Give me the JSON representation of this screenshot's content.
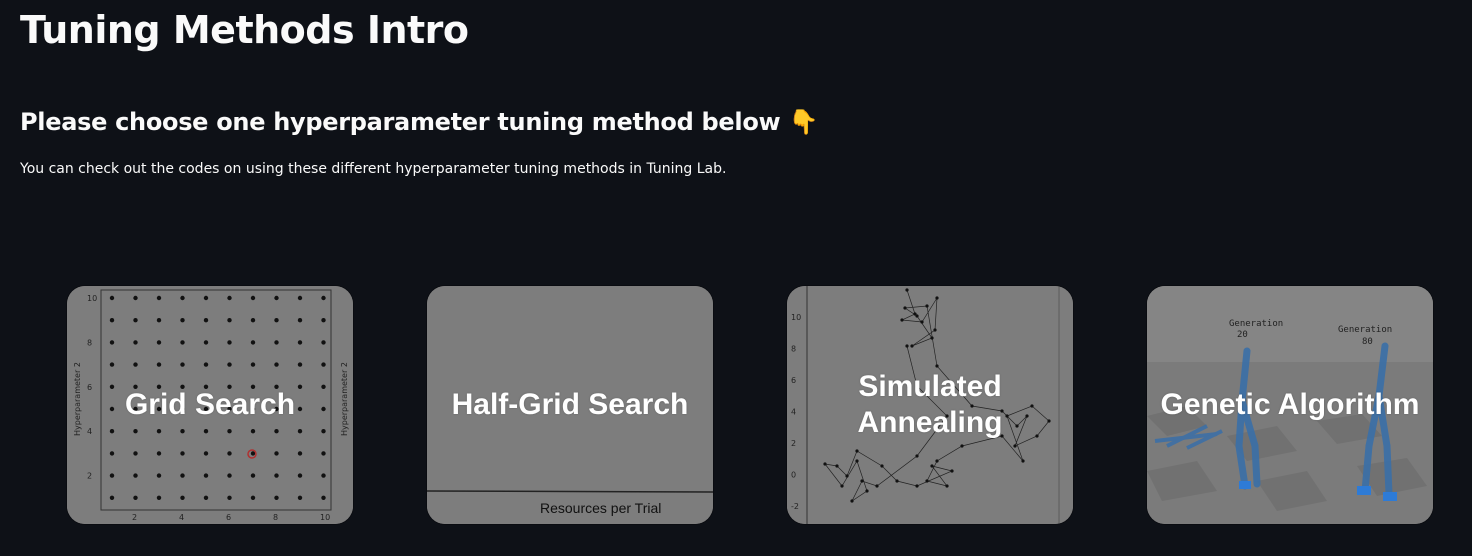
{
  "page": {
    "title": "Tuning Methods Intro",
    "subtitle": "Please choose one hyperparameter tuning method below",
    "subtitle_emoji": "👇",
    "description": "You can check out the codes on using these different hyperparameter tuning methods in Tuning Lab."
  },
  "cards": [
    {
      "label": "Grid Search",
      "image": {
        "y_axis_label": "Hyperparameter 2",
        "y_ticks": [
          "10",
          "8",
          "6",
          "4",
          "2"
        ],
        "x_ticks": [
          "2",
          "4",
          "6",
          "8",
          "10"
        ]
      }
    },
    {
      "label": "Half-Grid Search",
      "image": {
        "x_axis_label": "Resources per Trial"
      }
    },
    {
      "label": "Simulated\nAnnealing",
      "image": {
        "y_ticks": [
          "10",
          "8",
          "6",
          "4",
          "2",
          "0",
          "-2"
        ]
      }
    },
    {
      "label": "Genetic Algorithm",
      "image": {
        "annotations": [
          {
            "text": "Generation"
          },
          {
            "text": "20"
          },
          {
            "text": "Generation"
          },
          {
            "text": "80"
          }
        ]
      }
    }
  ],
  "colors": {
    "background": "#0e1117",
    "text": "#fafafa",
    "card_overlay": "#7d7d7d"
  }
}
